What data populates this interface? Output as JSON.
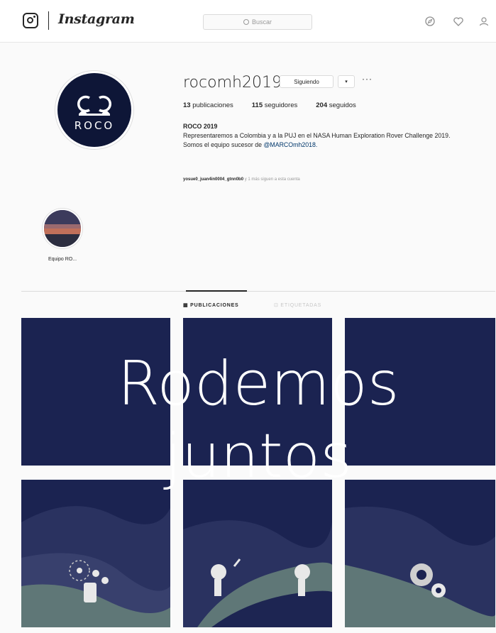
{
  "header": {
    "wordmark": "Instagram",
    "search_placeholder": "Buscar"
  },
  "profile": {
    "username": "rocomh2019",
    "follow_label": "Siguiendo",
    "dropdown_label": "▾",
    "more_label": "···",
    "avatar_text": "ROCO",
    "stats": {
      "posts_count": "13",
      "posts_label": "publicaciones",
      "followers_count": "115",
      "followers_label": "seguidores",
      "following_count": "204",
      "following_label": "seguidos"
    },
    "bio": {
      "name": "ROCO 2019",
      "line1": "Representaremos a Colombia y a la PUJ en el NASA Human Exploration Rover Challenge 2019.",
      "line2_prefix": "Somos el equipo sucesor de ",
      "line2_link": "@MARCOmh2018."
    },
    "followed_by_names": "yosue0_juan4in0004_gtnn0b0",
    "followed_by_suffix": "y 1 más siguen a esta cuenta"
  },
  "highlights": [
    {
      "label": "Equipo RO..."
    }
  ],
  "tabs": {
    "posts": "PUBLICACIONES",
    "tagged": "ETIQUETADAS"
  },
  "grid": {
    "line1": "Rodemos",
    "line2": "juntos"
  },
  "colors": {
    "tile_navy": "#1b2351",
    "avatar_navy": "#0e1637",
    "accent_link": "#00376b"
  }
}
